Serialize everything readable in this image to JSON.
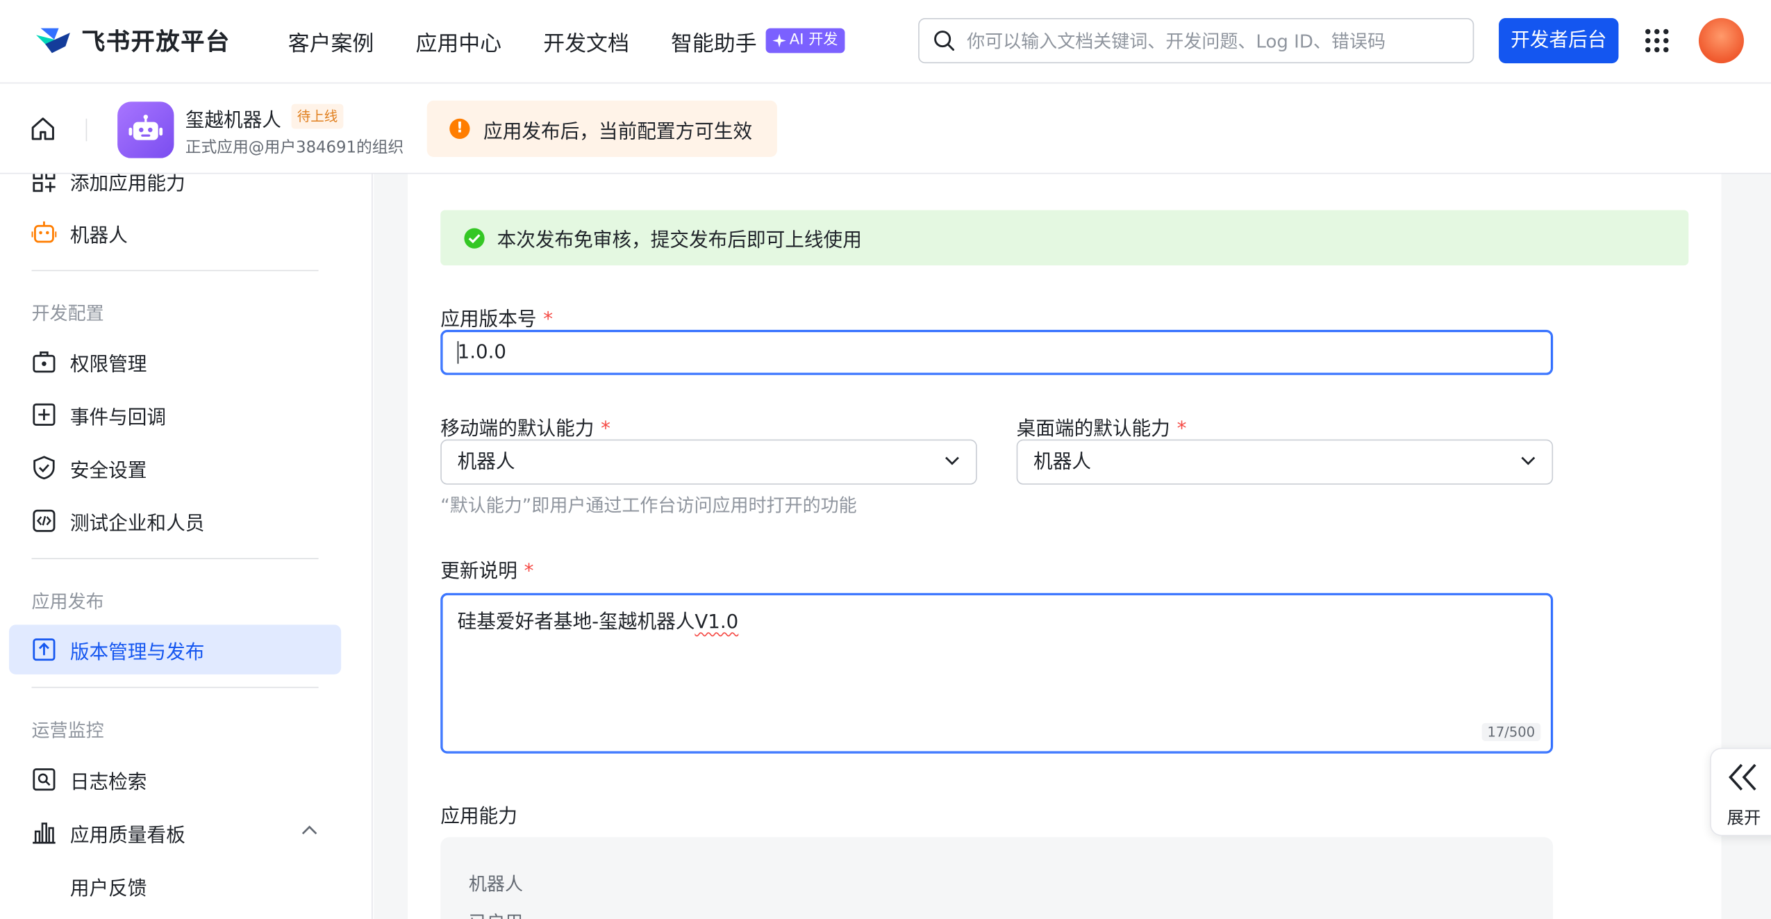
{
  "brand": {
    "name": "飞书开放平台"
  },
  "nav": {
    "items": [
      "客户案例",
      "应用中心",
      "开发文档",
      "智能助手"
    ],
    "ai_badge": "AI 开发"
  },
  "search": {
    "placeholder": "你可以输入文档关键词、开发问题、Log ID、错误码"
  },
  "header": {
    "dev_console": "开发者后台"
  },
  "app": {
    "name": "玺越机器人",
    "status": "待上线",
    "org": "正式应用@用户384691的组织",
    "notice": "应用发布后，当前配置方可生效"
  },
  "sidebar": {
    "top_items": [
      "添加应用能力",
      "机器人"
    ],
    "sections": [
      {
        "title": "开发配置",
        "items": [
          "权限管理",
          "事件与回调",
          "安全设置",
          "测试企业和人员"
        ]
      },
      {
        "title": "应用发布",
        "items": [
          "版本管理与发布"
        ]
      },
      {
        "title": "运营监控",
        "items": [
          "日志检索",
          "应用质量看板",
          "用户反馈"
        ]
      }
    ]
  },
  "form": {
    "banner": "本次发布免审核，提交发布后即可上线使用",
    "version_label": "应用版本号",
    "version_value": "1.0.0",
    "mobile_label": "移动端的默认能力",
    "mobile_value": "机器人",
    "desktop_label": "桌面端的默认能力",
    "desktop_value": "机器人",
    "hint": "“默认能力”即用户通过工作台访问应用时打开的功能",
    "notes_label": "更新说明",
    "notes_prefix": "硅基爱好者基地-玺越机器人",
    "notes_spell": "V1.0",
    "notes_counter": "17/500",
    "capability_label": "应用能力",
    "capability_items": [
      "机器人",
      "已启用"
    ],
    "required_mark": "*"
  },
  "expand": {
    "label": "展开"
  },
  "colors": {
    "primary": "#1456f0",
    "focus_border": "#3370ff",
    "success_bg": "#e4f8e1",
    "warning_bg": "#fff3e8",
    "required": "#f54a45",
    "sidebar_active_bg": "#e1eaff"
  }
}
